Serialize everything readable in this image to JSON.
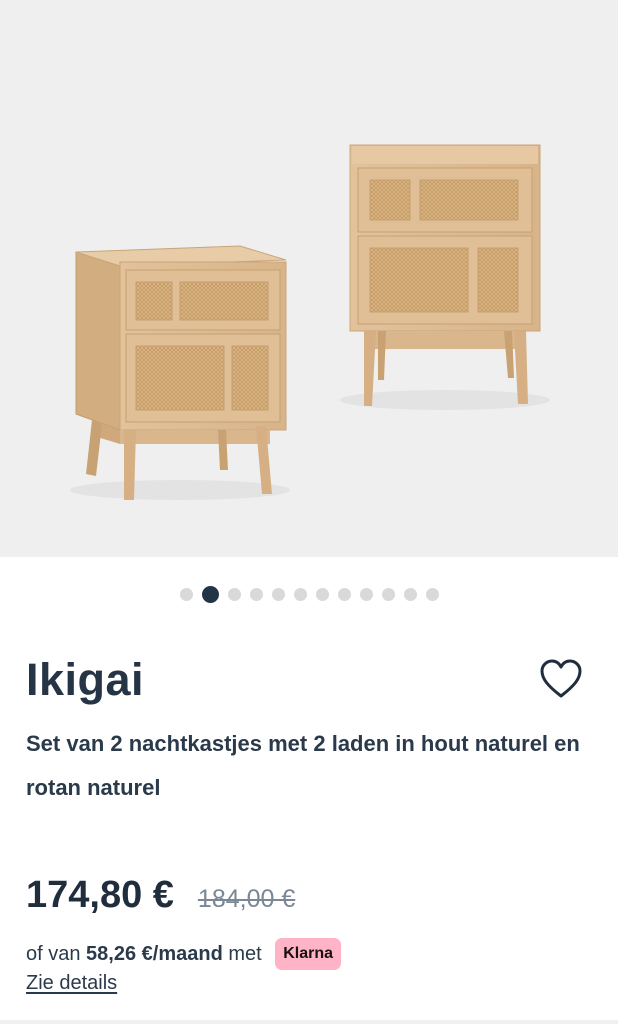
{
  "product": {
    "brand": "Ikigai",
    "title": "Set van 2 nachtkastjes met 2 laden in hout naturel en rotan naturel",
    "image_alt": "nightstand-set-photo"
  },
  "carousel": {
    "total_slides": 12,
    "active_index": 1
  },
  "pricing": {
    "current_price": "174,80 €",
    "old_price": "184,00 €",
    "installment_prefix": "of van ",
    "installment_amount": "58,26 €/maand",
    "installment_suffix": " met ",
    "klarna_label": "Klarna",
    "details_link": "Zie details"
  },
  "colors": {
    "text_primary": "#263545",
    "dot_active": "#243447",
    "dot_inactive": "#d9d9d9",
    "klarna_pink": "#ffb3c7",
    "image_background": "#efefef"
  },
  "icons": {
    "wishlist": "heart-outline-icon"
  }
}
